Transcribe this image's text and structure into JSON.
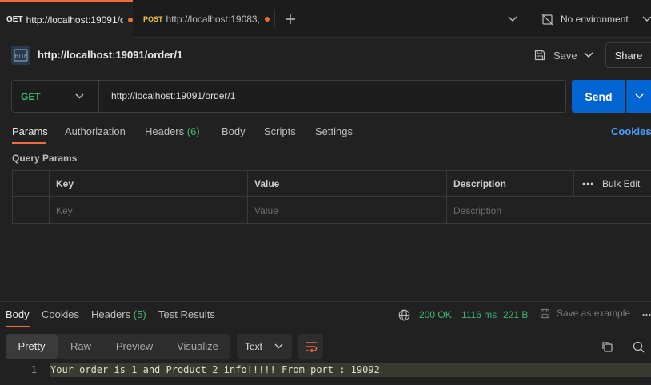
{
  "tabs": [
    {
      "method": "GET",
      "title": "http://localhost:19091/c",
      "unsaved": true
    },
    {
      "method": "POST",
      "title": "http://localhost:19083,",
      "unsaved": true
    }
  ],
  "environment": {
    "label": "No environment"
  },
  "request": {
    "name": "http://localhost:19091/order/1",
    "method": "GET",
    "url": "http://localhost:19091/order/1",
    "save_label": "Save",
    "share_label": "Share",
    "send_label": "Send"
  },
  "request_tabs": {
    "params": "Params",
    "authorization": "Authorization",
    "headers": "Headers",
    "headers_count": "(6)",
    "body": "Body",
    "scripts": "Scripts",
    "settings": "Settings",
    "cookies": "Cookies"
  },
  "query_params": {
    "title": "Query Params",
    "columns": {
      "key": "Key",
      "value": "Value",
      "description": "Description"
    },
    "bulk_edit": "Bulk Edit",
    "placeholders": {
      "key": "Key",
      "value": "Value",
      "description": "Description"
    }
  },
  "response_tabs": {
    "body": "Body",
    "cookies": "Cookies",
    "headers": "Headers",
    "headers_count": "(5)",
    "test_results": "Test Results"
  },
  "response_meta": {
    "status": "200 OK",
    "time": "1116 ms",
    "size": "221 B",
    "save_example": "Save as example"
  },
  "view_modes": [
    "Pretty",
    "Raw",
    "Preview",
    "Visualize"
  ],
  "format": "Text",
  "response_lines": [
    {
      "number": "1",
      "text": "Your order is 1 and Product 2 info!!!!! From port : 19092"
    }
  ],
  "colors": {
    "accent": "#f26b3a",
    "send": "#0265d2",
    "success": "#3fb774",
    "link": "#4a9eff"
  }
}
